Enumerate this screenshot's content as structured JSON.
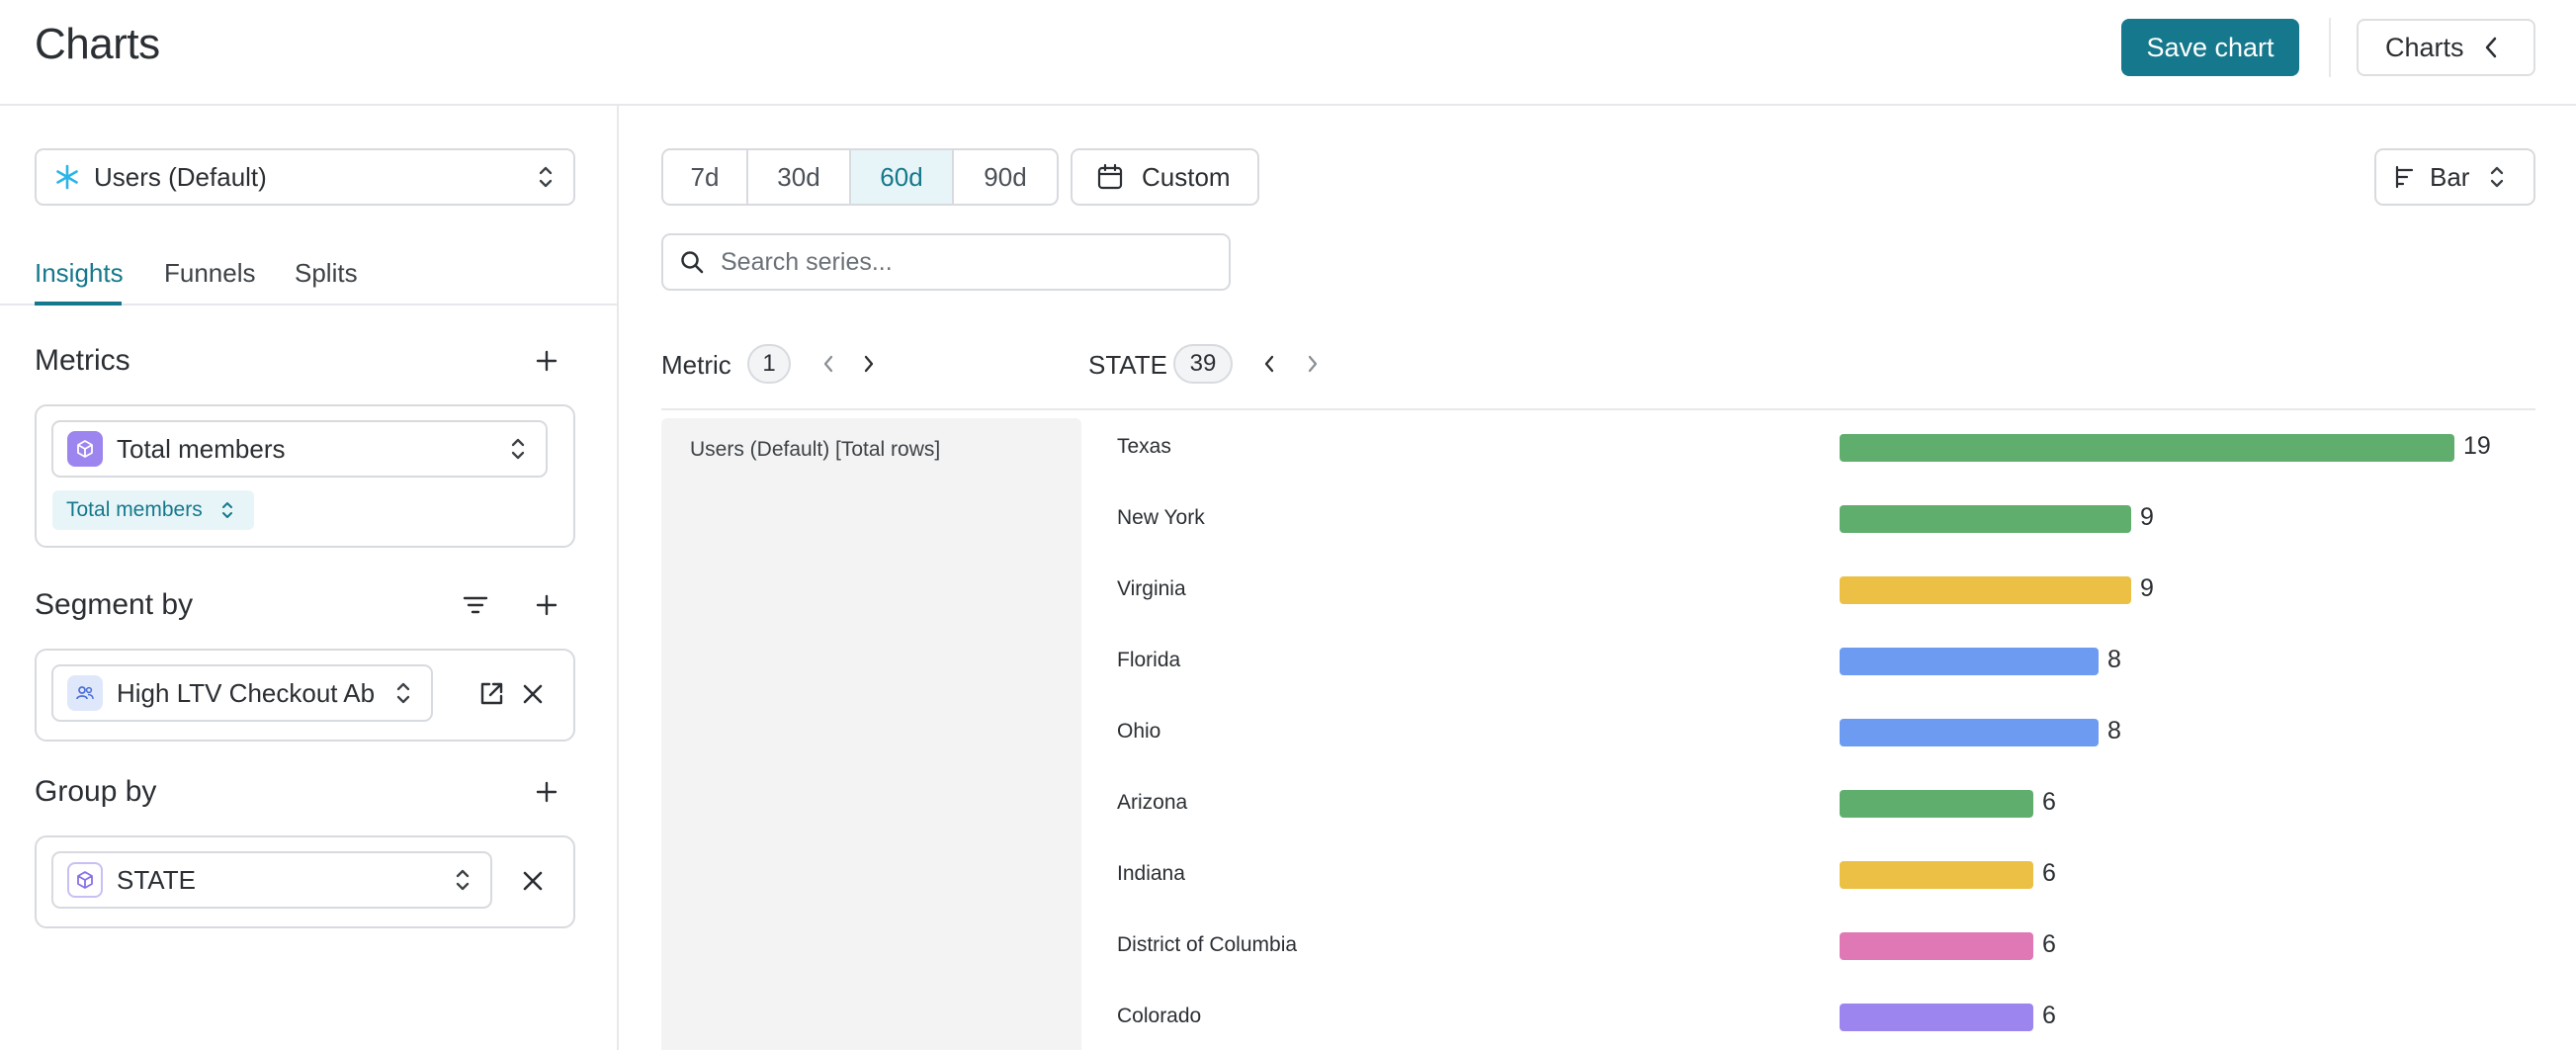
{
  "header": {
    "title": "Charts",
    "save_label": "Save chart",
    "charts_label": "Charts"
  },
  "sidebar": {
    "source_select": "Users (Default)",
    "tabs": [
      {
        "label": "Insights",
        "active": true
      },
      {
        "label": "Funnels",
        "active": false
      },
      {
        "label": "Splits",
        "active": false
      }
    ],
    "metrics": {
      "title": "Metrics",
      "select_value": "Total members",
      "pill_label": "Total members"
    },
    "segment_by": {
      "title": "Segment by",
      "select_value": "High LTV Checkout Ab"
    },
    "group_by": {
      "title": "Group by",
      "select_value": "STATE"
    }
  },
  "main": {
    "ranges": [
      {
        "label": "7d",
        "active": false
      },
      {
        "label": "30d",
        "active": false
      },
      {
        "label": "60d",
        "active": true
      },
      {
        "label": "90d",
        "active": false
      }
    ],
    "custom_label": "Custom",
    "chart_type_label": "Bar",
    "search_placeholder": "Search series...",
    "metric_label": "Metric",
    "metric_count": "1",
    "state_label": "STATE",
    "state_count": "39",
    "series_name": "Users (Default) [Total rows]"
  },
  "colors": {
    "accent": "#15788c",
    "green": "#5fae6e",
    "yellow": "#ecc044",
    "blue": "#6e9bf2",
    "pink": "#df78b5",
    "purple": "#9d85ef"
  },
  "chart_data": {
    "type": "bar",
    "orientation": "horizontal",
    "categories": [
      "Texas",
      "New York",
      "Virginia",
      "Florida",
      "Ohio",
      "Arizona",
      "Indiana",
      "District of Columbia",
      "Colorado"
    ],
    "values": [
      19,
      9,
      9,
      8,
      8,
      6,
      6,
      6,
      6
    ],
    "bar_colors": [
      "#5fae6e",
      "#5fae6e",
      "#ecc044",
      "#6e9bf2",
      "#6e9bf2",
      "#5fae6e",
      "#ecc044",
      "#df78b5",
      "#9d85ef"
    ]
  }
}
